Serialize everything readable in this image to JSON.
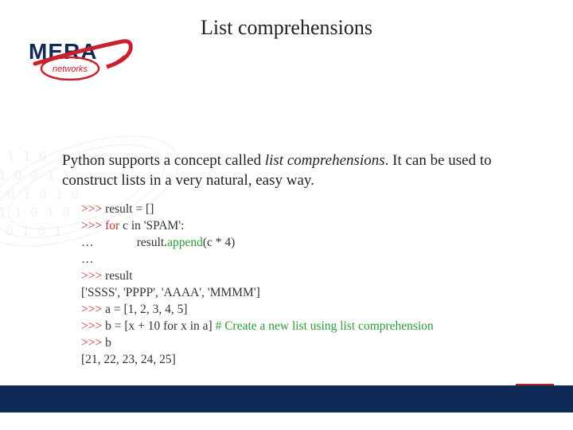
{
  "title": "List comprehensions",
  "logo": {
    "text_main": "MERA",
    "text_sub": "networks"
  },
  "intro": {
    "pre": "Python supports a concept called ",
    "ital": "list comprehensions",
    "post": ". It can be used to construct lists in a very natural, easy way."
  },
  "code": {
    "l1_prompt": ">>> ",
    "l1_rest": "result = []",
    "l2_prompt": ">>> ",
    "l2_kw": "for",
    "l2_rest": " c in 'SPAM':",
    "l3_dots": "…",
    "l3_pad": "              result.",
    "l3_fn": "append",
    "l3_rest": "(c * 4)",
    "l4": "…",
    "l5_prompt": ">>> ",
    "l5_rest": "result",
    "l6": "['SSSS', 'PPPP', 'AAAA', 'MMMM']",
    "l7_prompt": ">>> ",
    "l7_rest": "a = [1, 2, 3, 4, 5]",
    "l8_prompt": ">>> ",
    "l8_rest": "b = [x + 10 for x in a] ",
    "l8_cm": "# Create a new list using list comprehension",
    "l9_prompt": ">>> ",
    "l9_rest": "b",
    "l10": "[21, 22, 23, 24, 25]"
  }
}
